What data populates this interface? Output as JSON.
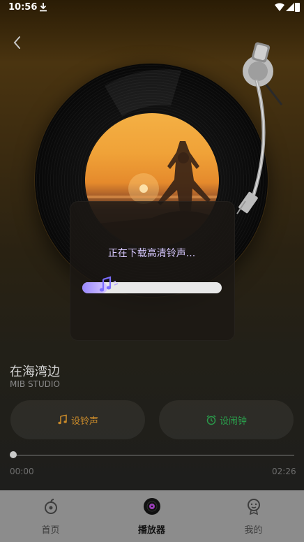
{
  "status_bar": {
    "time": "10:56"
  },
  "player": {
    "song_title": "在海湾边",
    "artist": "MIB STUDIO",
    "progress": {
      "current": "00:00",
      "total": "02:26",
      "fraction": 0.0
    }
  },
  "dialog": {
    "message": "正在下载高清铃声...",
    "progress_fraction": 0.13
  },
  "actions": {
    "ringtone_label": "设铃声",
    "alarm_label": "设闹钟"
  },
  "tabs": [
    {
      "label": "首页",
      "icon": "home-icon",
      "active": false
    },
    {
      "label": "播放器",
      "icon": "vinyl-icon",
      "active": true
    },
    {
      "label": "我的",
      "icon": "profile-icon",
      "active": false
    }
  ],
  "colors": {
    "ringtone_accent": "#c7892a",
    "alarm_accent": "#2a9a4a",
    "dialog_text": "#d7c8ff",
    "progress_fill": "#9a88ff"
  }
}
